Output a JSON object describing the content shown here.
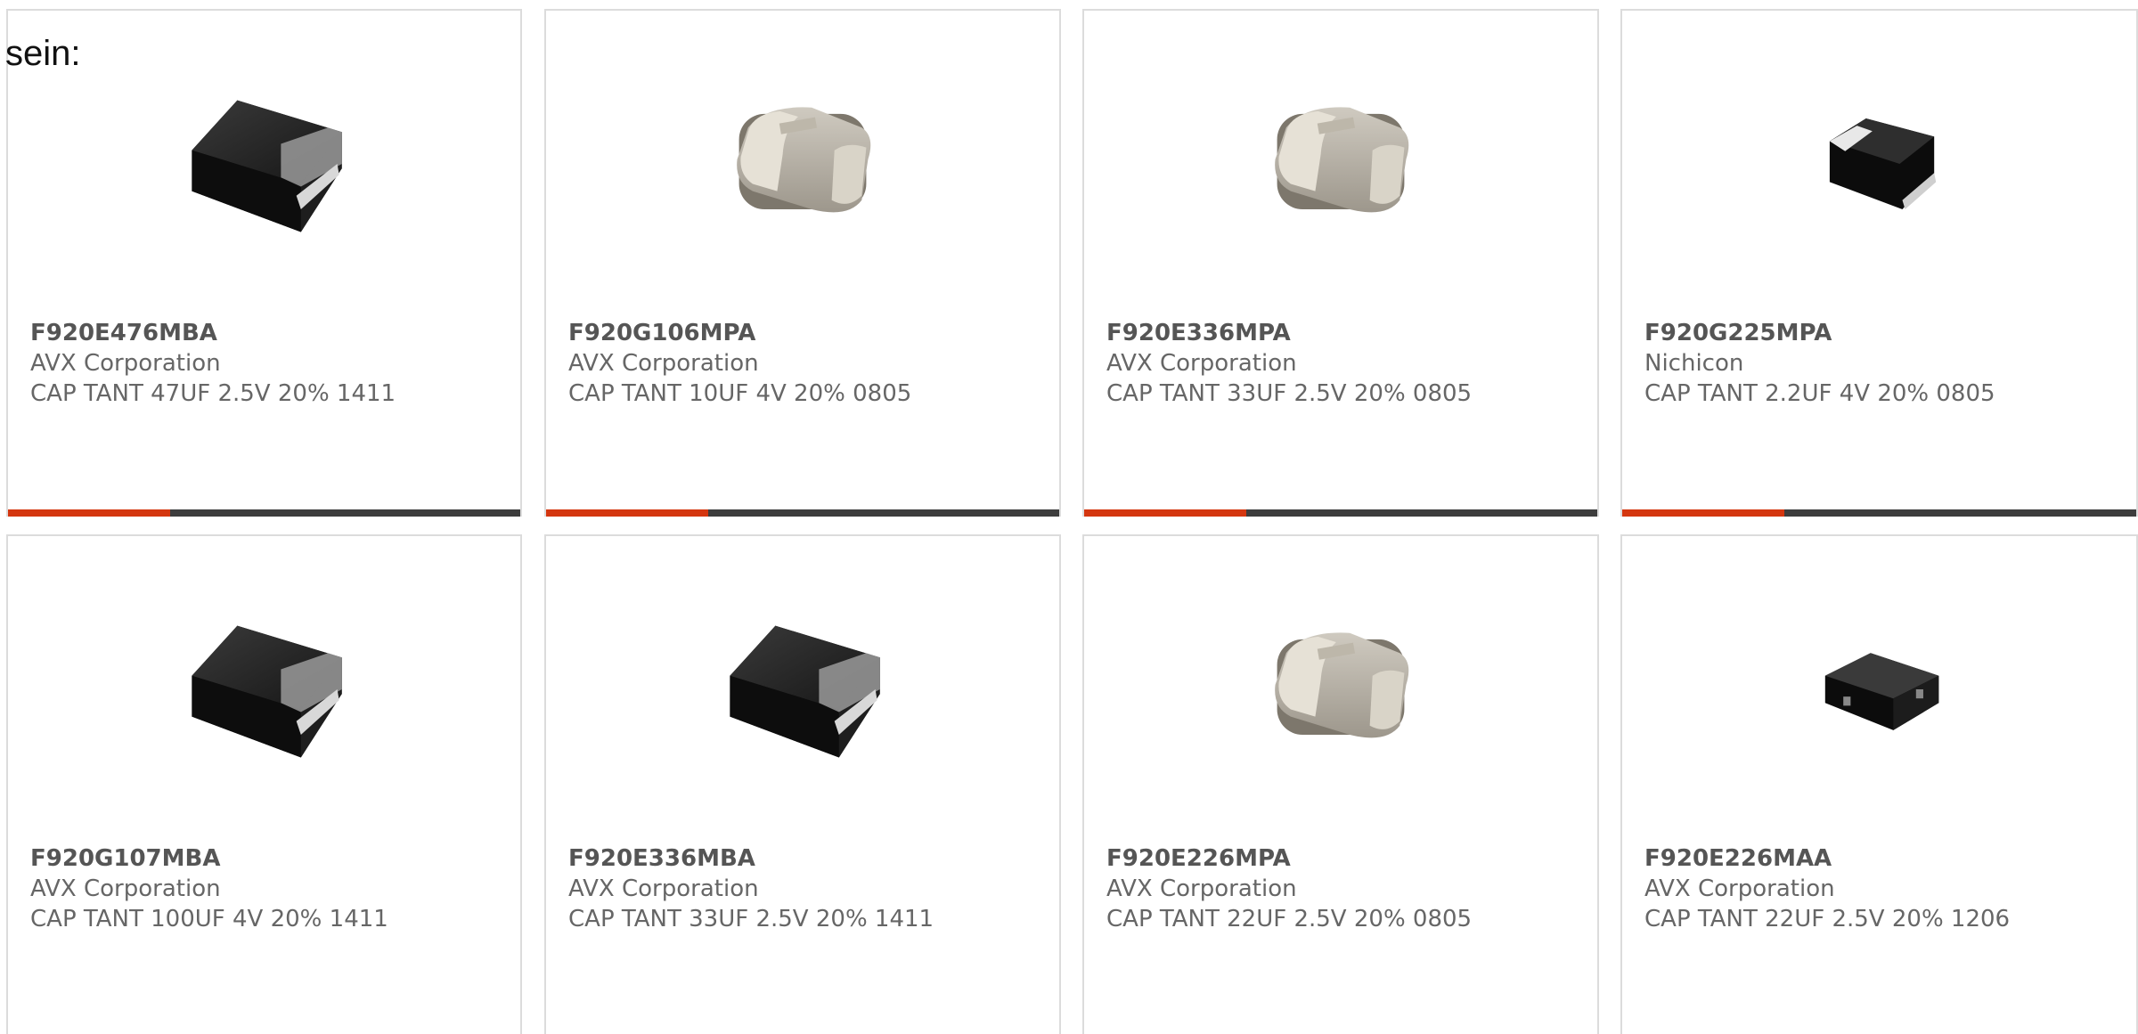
{
  "intro_text": "sein:",
  "colors": {
    "accent": "#d4360f",
    "bar_dark": "#3d3d3d",
    "card_border": "#dcdcdc",
    "text": "#666666",
    "part_number": "#555555"
  },
  "products": [
    {
      "part_number": "F920E476MBA",
      "manufacturer": "AVX Corporation",
      "description": "CAP TANT 47UF 2.5V 20% 1411",
      "image": "black-molded-tantalum-icon"
    },
    {
      "part_number": "F920G106MPA",
      "manufacturer": "AVX Corporation",
      "description": "CAP TANT 10UF 4V 20% 0805",
      "image": "grey-ceramic-chip-icon"
    },
    {
      "part_number": "F920E336MPA",
      "manufacturer": "AVX Corporation",
      "description": "CAP TANT 33UF 2.5V 20% 0805",
      "image": "grey-ceramic-chip-icon"
    },
    {
      "part_number": "F920G225MPA",
      "manufacturer": "Nichicon",
      "description": "CAP TANT 2.2UF 4V 20% 0805",
      "image": "small-black-tantalum-icon"
    },
    {
      "part_number": "F920G107MBA",
      "manufacturer": "AVX Corporation",
      "description": "CAP TANT 100UF 4V 20% 1411",
      "image": "black-molded-tantalum-icon"
    },
    {
      "part_number": "F920E336MBA",
      "manufacturer": "AVX Corporation",
      "description": "CAP TANT 33UF 2.5V 20% 1411",
      "image": "black-molded-tantalum-icon"
    },
    {
      "part_number": "F920E226MPA",
      "manufacturer": "AVX Corporation",
      "description": "CAP TANT 22UF 2.5V 20% 0805",
      "image": "grey-ceramic-chip-icon"
    },
    {
      "part_number": "F920E226MAA",
      "manufacturer": "AVX Corporation",
      "description": "CAP TANT 22UF 2.5V 20% 1206",
      "image": "slim-black-tantalum-icon"
    }
  ]
}
